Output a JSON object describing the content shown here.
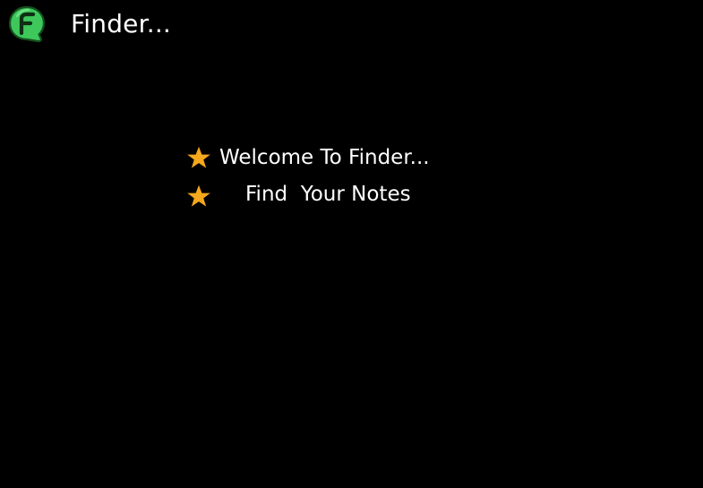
{
  "header": {
    "logo_icon": "finder-speech-bubble-logo-icon",
    "title": "Finder..."
  },
  "welcome": {
    "items": [
      {
        "icon": "star-icon",
        "text": "Welcome To Finder..."
      },
      {
        "icon": "star-icon",
        "text": "Find  Your Notes"
      }
    ]
  },
  "colors": {
    "background": "#000000",
    "text": "#ffffff",
    "star": "#f5a81c",
    "logo_green": "#3ec85c",
    "logo_dark": "#14501e"
  }
}
